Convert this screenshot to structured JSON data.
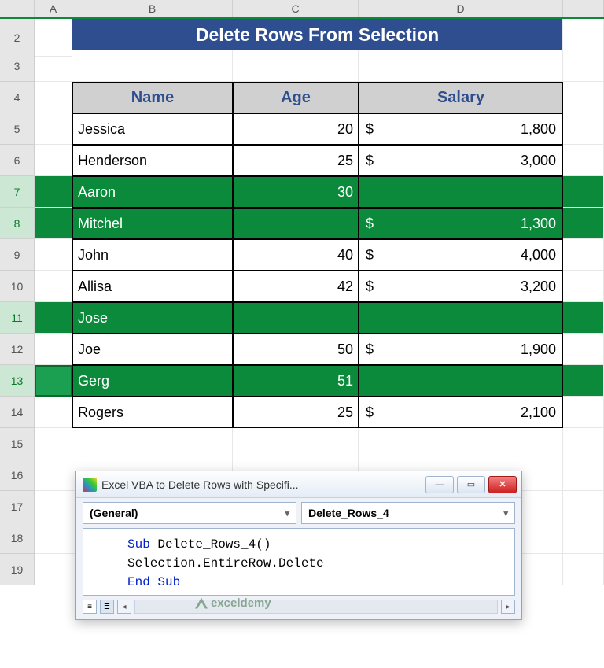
{
  "columns": [
    "",
    "A",
    "B",
    "C",
    "D",
    ""
  ],
  "row_numbers": [
    2,
    3,
    4,
    5,
    6,
    7,
    8,
    9,
    10,
    11,
    12,
    13,
    14,
    15,
    16,
    17,
    18,
    19
  ],
  "selected_rows": [
    7,
    8,
    11,
    13
  ],
  "title": "Delete Rows From Selection",
  "headers": {
    "name": "Name",
    "age": "Age",
    "salary": "Salary"
  },
  "rows": [
    {
      "r": 5,
      "name": "Jessica",
      "age": "20",
      "cur": "$",
      "amt": "1,800"
    },
    {
      "r": 6,
      "name": "Henderson",
      "age": "25",
      "cur": "$",
      "amt": "3,000"
    },
    {
      "r": 7,
      "name": "Aaron",
      "age": "30",
      "cur": "",
      "amt": ""
    },
    {
      "r": 8,
      "name": "Mitchel",
      "age": "",
      "cur": "$",
      "amt": "1,300"
    },
    {
      "r": 9,
      "name": "John",
      "age": "40",
      "cur": "$",
      "amt": "4,000"
    },
    {
      "r": 10,
      "name": "Allisa",
      "age": "42",
      "cur": "$",
      "amt": "3,200"
    },
    {
      "r": 11,
      "name": "Jose",
      "age": "",
      "cur": "",
      "amt": ""
    },
    {
      "r": 12,
      "name": "Joe",
      "age": "50",
      "cur": "$",
      "amt": "1,900"
    },
    {
      "r": 13,
      "name": "Gerg",
      "age": "51",
      "cur": "",
      "amt": ""
    },
    {
      "r": 14,
      "name": "Rogers",
      "age": "25",
      "cur": "$",
      "amt": "2,100"
    }
  ],
  "vba": {
    "title": "Excel VBA to Delete Rows with Specifi...",
    "dropdown_left": "(General)",
    "dropdown_right": "Delete_Rows_4",
    "code_kw1": "Sub",
    "code_name": " Delete_Rows_4()",
    "code_line2": "Selection.EntireRow.Delete",
    "code_kw2": "End Sub"
  },
  "watermark": "exceldemy"
}
